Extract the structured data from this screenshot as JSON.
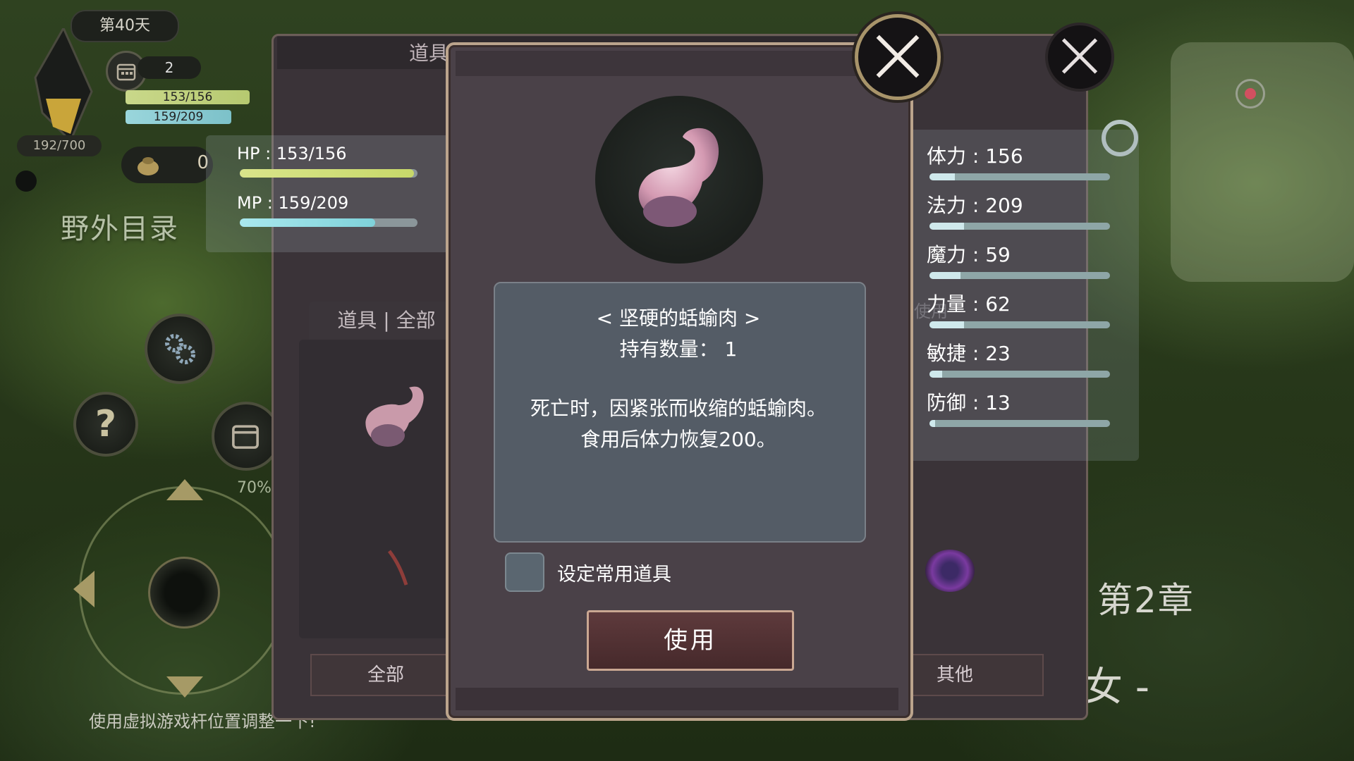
{
  "hud": {
    "day": "第40天",
    "calendar_count": "2",
    "hp_text": "153/156",
    "mp_text": "159/209",
    "exp_text": "192/700",
    "bag_count": "0",
    "field_menu": "野外目录",
    "percent": "70%",
    "hint": "使用虚拟游戏杆位置调整一下!"
  },
  "world": {
    "chapter": "第2章",
    "subtitle": "魔女 -"
  },
  "storage": {
    "title": "道具保管箱",
    "list_tab": "道具 | 全部",
    "tab_all": "全部",
    "tab_other": "其他",
    "faint_text": "具即可使用"
  },
  "status": {
    "hp_label": "HP : 153/156",
    "mp_label": "MP : 159/209",
    "hp_fraction": 0.98,
    "mp_fraction": 0.76
  },
  "stats": [
    {
      "label": "体力 : 156",
      "fill": 0.14
    },
    {
      "label": "法力 : 209",
      "fill": 0.19
    },
    {
      "label": "魔力 : 59",
      "fill": 0.17
    },
    {
      "label": "力量 : 62",
      "fill": 0.19
    },
    {
      "label": "敏捷 : 23",
      "fill": 0.07
    },
    {
      "label": "防御 : 13",
      "fill": 0.03
    }
  ],
  "modal": {
    "item_name": "< 坚硬的蛞蝓肉 >",
    "count_label": "持有数量： 1",
    "description_lines": [
      "死亡时，因紧张而收缩的蛞蝓肉。",
      "食用后体力恢复200。"
    ],
    "favorite_label": "设定常用道具",
    "use_label": "使用"
  },
  "colors": {
    "accent_gold": "#bba48c",
    "hp_bar": "#c7d86a",
    "mp_bar": "#7fd2da",
    "use_button": "#4f3033"
  },
  "icons": [
    "crystal-icon",
    "calendar-icon",
    "bag-icon",
    "gear-icon",
    "help-icon",
    "close-icon",
    "slug-meat-icon",
    "target-icon",
    "gps-icon",
    "orb-icon"
  ]
}
